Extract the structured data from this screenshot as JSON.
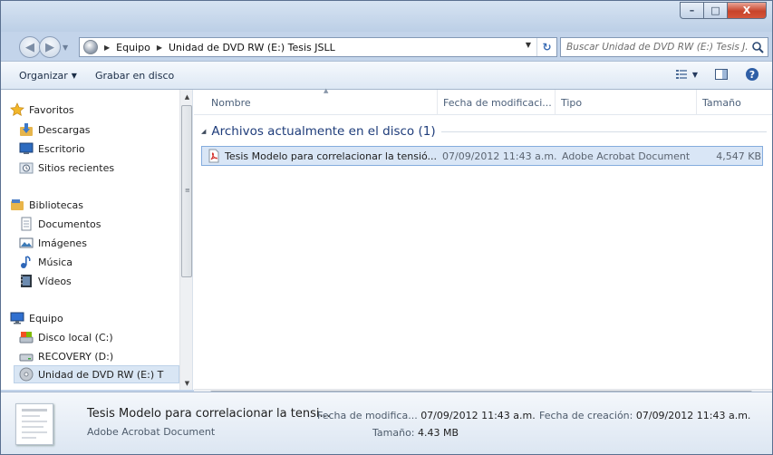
{
  "window": {
    "minimize": "–",
    "maximize": "□",
    "close": "X"
  },
  "address": {
    "crumbs": [
      "Equipo",
      "Unidad de DVD RW (E:) Tesis JSLL"
    ]
  },
  "search": {
    "placeholder": "Buscar Unidad de DVD RW (E:) Tesis J..."
  },
  "toolbar": {
    "organize": "Organizar",
    "burn": "Grabar en disco"
  },
  "nav": {
    "favorites": "Favoritos",
    "downloads": "Descargas",
    "desktop": "Escritorio",
    "recent": "Sitios recientes",
    "libraries": "Bibliotecas",
    "documents": "Documentos",
    "pictures": "Imágenes",
    "music": "Música",
    "videos": "Vídeos",
    "computer": "Equipo",
    "local_disk": "Disco local (C:)",
    "recovery": "RECOVERY (D:)",
    "dvd": "Unidad de DVD RW (E:) T"
  },
  "columns": {
    "name": "Nombre",
    "date": "Fecha de modificaci...",
    "type": "Tipo",
    "size": "Tamaño"
  },
  "group": {
    "label": "Archivos actualmente en el disco (1)"
  },
  "files": [
    {
      "name": "Tesis Modelo para correlacionar la tensió...",
      "date": "07/09/2012 11:43 a.m.",
      "type": "Adobe Acrobat Document",
      "size": "4,547 KB"
    }
  ],
  "details": {
    "name": "Tesis Modelo para correlacionar la tensi...",
    "type": "Adobe Acrobat Document",
    "modified_label": "Fecha de modifica...",
    "modified_value": "07/09/2012 11:43 a.m.",
    "created_label": "Fecha de creación:",
    "created_value": "07/09/2012 11:43 a.m.",
    "size_label": "Tamaño:",
    "size_value": "4.43 MB"
  },
  "colors": {
    "accent": "#1e3c7a",
    "selection": "#d9e6f6",
    "chrome": "#c3d4ea"
  }
}
